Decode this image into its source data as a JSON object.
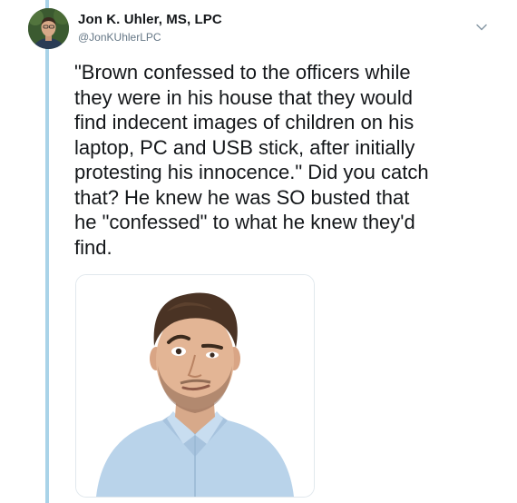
{
  "tweet": {
    "author": {
      "display_name": "Jon K. Uhler, MS, LPC",
      "handle": "@JonKUhlerLPC"
    },
    "menu_icon": "chevron-down-icon",
    "text": "\"Brown confessed to the officers while\nthey were in his house that they would\nfind indecent images of children on his\nlaptop, PC and USB stick, after initially\nprotesting his innocence.\" Did you catch\nthat? He knew he was SO busted that\nhe \"confessed\" to what he knew they'd\nfind.",
    "media": {
      "type": "photo"
    }
  },
  "colors": {
    "thread_line": "#a9d3e8",
    "text_primary": "#14171a",
    "text_secondary": "#657786",
    "media_border": "#e1e8ed"
  }
}
